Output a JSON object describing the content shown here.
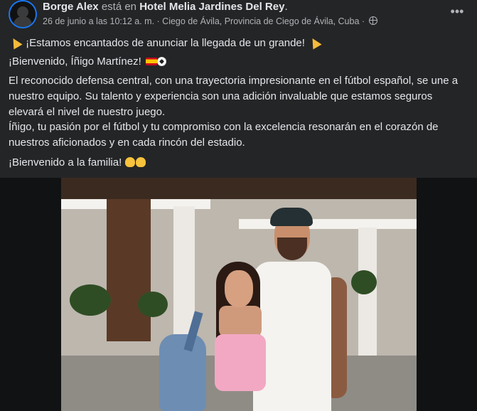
{
  "post": {
    "author": "Borge Alex",
    "is_at": "está en",
    "place": "Hotel Melia Jardines Del Rey",
    "period": ".",
    "date": "26 de junio a las 10:12 a. m.",
    "location": "Ciego de Ávila, Provincia de Ciego de Ávila, Cuba",
    "separator": " · ",
    "privacy_icon": "globe-icon",
    "more_icon": "more-dots-icon",
    "paragraphs": [
      "¡Estamos encantados de anunciar la llegada de un grande!",
      "¡Bienvenido, Íñigo Martínez!",
      "El reconocido defensa central, con una trayectoria impresionante en el fútbol español, se une a nuestro equipo. Su talento y experiencia son una adición invaluable que estamos seguros elevará el nivel de nuestro juego.",
      "Íñigo, tu pasión por el fútbol y tu compromiso con la excelencia resonarán en el corazón de nuestros aficionados y en cada rincón del estadio.",
      "¡Bienvenido a la familia!"
    ]
  },
  "icons": {
    "confetti": "party-popper-icon",
    "flag": "spain-flag-icon",
    "ball": "soccer-ball-icon",
    "clap": "clapping-hands-icon"
  },
  "colors": {
    "background": "#242526",
    "text": "#e4e6eb",
    "muted": "#b0b3b8",
    "accent": "#1877f2"
  }
}
